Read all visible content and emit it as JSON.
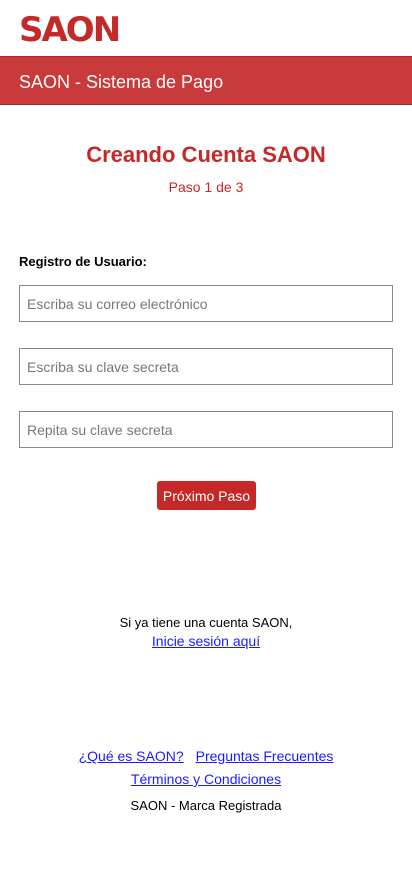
{
  "brand": {
    "logo_text": "SAON"
  },
  "header": {
    "title": "SAON - Sistema de Pago"
  },
  "main": {
    "title": "Creando Cuenta SAON",
    "step": "Paso 1 de 3",
    "section_label": "Registro de Usuario:",
    "fields": {
      "email": {
        "placeholder": "Escriba su correo electrónico",
        "value": ""
      },
      "password": {
        "placeholder": "Escriba su clave secreta",
        "value": ""
      },
      "password_repeat": {
        "placeholder": "Repita su clave secreta",
        "value": ""
      }
    },
    "next_button_label": "Próximo Paso"
  },
  "login": {
    "prompt": "Si ya tiene una cuenta SAON,",
    "link_label": "Inicie sesión aquí"
  },
  "footer": {
    "links": {
      "what_is": "¿Qué es SAON?",
      "faq": "Preguntas Frecuentes",
      "terms": "Términos y Condiciones"
    },
    "trademark": "SAON - Marca Registrada"
  },
  "colors": {
    "brand_red": "#c62828",
    "header_red": "#c93a3a",
    "link_blue": "#1a1aff"
  }
}
